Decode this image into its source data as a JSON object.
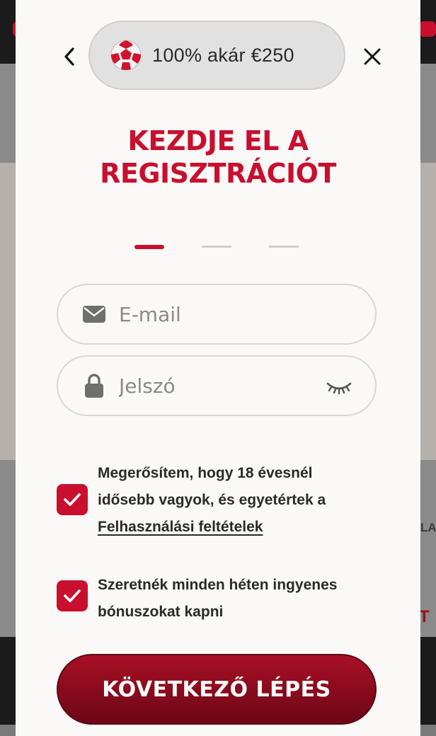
{
  "background": {
    "side_text": "LA",
    "side_red_text": "T"
  },
  "header": {
    "bonus_text": "100% akár €250",
    "ball_icon": "soccer-ball-icon",
    "back_icon": "chevron-left-icon",
    "close_icon": "close-icon"
  },
  "title": {
    "line1": "KEZDJE EL A",
    "line2": "REGISZTRÁCIÓT"
  },
  "steps": {
    "total": 3,
    "active": 1
  },
  "form": {
    "email": {
      "placeholder": "E-mail",
      "value": "",
      "icon": "envelope-icon"
    },
    "password": {
      "placeholder": "Jelszó",
      "value": "",
      "icon": "lock-icon",
      "toggle_icon": "eye-closed-icon"
    }
  },
  "consents": {
    "age": {
      "checked": true,
      "text_line1": "Megerősítem, hogy 18 évesnél",
      "text_line2": "idősebb vagyok, és egyetértek a",
      "link": "Felhasználási feltételek"
    },
    "bonus": {
      "checked": true,
      "text_line1": "Szeretnék minden héten ingyenes",
      "text_line2": "bónuszokat kapni"
    }
  },
  "buttons": {
    "next": "KÖVETKEZŐ LÉPÉS"
  },
  "colors": {
    "accent": "#c8102e",
    "button_dark": "#6c0716",
    "modal_bg": "#fbf9f8"
  }
}
